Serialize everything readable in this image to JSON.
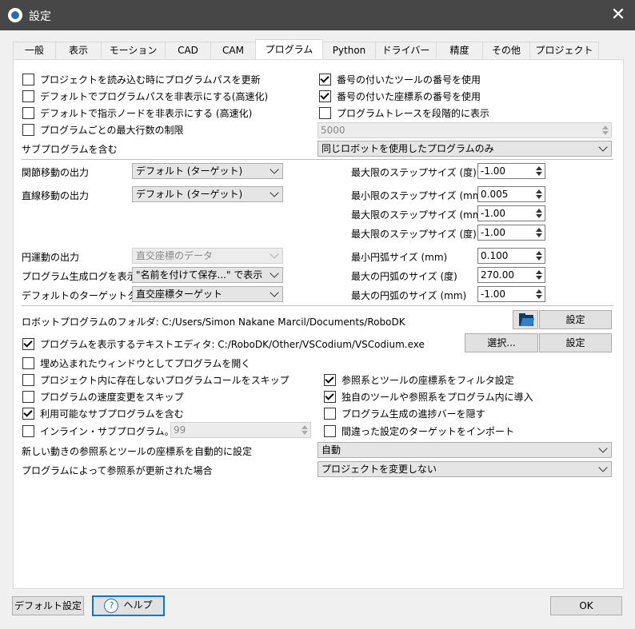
{
  "window": {
    "title": "設定",
    "close": "✕"
  },
  "tabs": [
    {
      "label": "一般",
      "w": 52
    },
    {
      "label": "表示",
      "w": 56
    },
    {
      "label": "モーション",
      "w": 79
    },
    {
      "label": "CAD",
      "w": 56
    },
    {
      "label": "CAM",
      "w": 55
    },
    {
      "label": "プログラム",
      "w": 83
    },
    {
      "label": "Python",
      "w": 65
    },
    {
      "label": "ドライバー",
      "w": 75
    },
    {
      "label": "精度",
      "w": 57
    },
    {
      "label": "その他",
      "w": 58
    },
    {
      "label": "プロジェクト",
      "w": 85
    }
  ],
  "options": {
    "update_path_on_load": "プロジェクトを読み込む時にプログラムパスを更新",
    "hide_program_path": "デフォルトでプログラムパスを非表示にする(高速化)",
    "hide_instruction_nodes": "デフォルトで指示ノードを非表示にする (高速化)",
    "limit_lines": "プログラムごとの最大行数の制限",
    "use_tool_numbers": "番号の付いたツールの番号を使用",
    "use_frame_numbers": "番号の付いた座標系の番号を使用",
    "trace_stepwise": "プログラムトレースを段階的に表示",
    "max_lines_value": "5000",
    "include_subprograms_label": "サブプログラムを含む",
    "include_subprograms_value": "同じロボットを使用したプログラムのみ"
  },
  "motion": {
    "joint_output_label": "関節移動の出力",
    "joint_output_value": "デフォルト (ターゲット)",
    "linear_output_label": "直線移動の出力",
    "linear_output_value": "デフォルト (ターゲット)",
    "circular_output_label": "円運動の出力",
    "circular_output_value": "直交座標のデータ",
    "log_label": "プログラム生成ログを表示",
    "log_value": "\"名前を付けて保存...\" で表示",
    "target_type_label": "デフォルトのターゲットタイプ",
    "target_type_value": "直交座標ターゲット",
    "steps": [
      {
        "label": "最大限のステップサイズ (度)",
        "value": "-1.00"
      },
      {
        "label": "最小限のステップサイズ (mm)",
        "value": "0.005"
      },
      {
        "label": "最大限のステップサイズ (mm)",
        "value": "-1.00"
      },
      {
        "label": "最大限のステップサイズ (度)",
        "value": "-1.00"
      },
      {
        "label": "最小円弧サイズ (mm)",
        "value": "0.100"
      },
      {
        "label": "最大の円弧のサイズ (度)",
        "value": "270.00"
      },
      {
        "label": "最大の円弧のサイズ (mm)",
        "value": "-1.00"
      }
    ]
  },
  "folder": {
    "label": "ロボットプログラムのフォルダ: C:/Users/Simon Nakane Marcil/Documents/RoboDK",
    "settings_button": "設定",
    "editor_label": "プログラムを表示するテキストエディタ:  C:/RoboDK/Other/VSCodium/VSCodium.exe",
    "select_button": "選択...",
    "settings_button2": "設定",
    "embed_window": "埋め込まれたウィンドウとしてプログラムを開く"
  },
  "misc": {
    "skip_missing_calls": "プロジェクト内に存在しないプログラムコールをスキップ",
    "skip_speed_changes": "プログラムの速度変更をスキップ",
    "include_available_subprograms": "利用可能なサブプログラムを含む",
    "inline_subprograms": "インライン・サブプログラム。深さ:",
    "inline_depth": "99",
    "filter_frames": "参照系とツールの座標系をフィルタ設定",
    "import_custom": "独自のツールや参照系をプログラム内に導入",
    "hide_progress": "プログラム生成の進捗バーを隠す",
    "import_wrong_targets": "間違った設定のターゲットをインポート",
    "auto_set_label": "新しい動きの参照系とツールの座標系を自動的に設定",
    "auto_set_value": "自動",
    "updated_label": "プログラムによって参照系が更新された場合",
    "updated_value": "プロジェクトを変更しない"
  },
  "footer": {
    "defaults": "デフォルト設定",
    "help": "ヘルプ",
    "help_icon": "?",
    "ok": "OK"
  }
}
